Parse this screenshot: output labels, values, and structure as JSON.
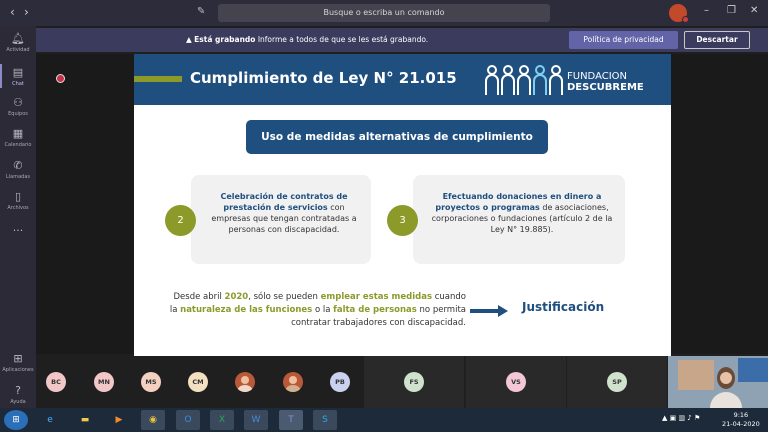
{
  "titlebar": {
    "back": "‹",
    "forward": "›",
    "search_placeholder": "Busque o escriba un comando",
    "minimize": "–",
    "maximize": "❐",
    "close": "✕"
  },
  "sidebar": {
    "items": [
      {
        "label": "Actividad",
        "icon": "bell-icon"
      },
      {
        "label": "Chat",
        "icon": "chat-icon"
      },
      {
        "label": "Equipos",
        "icon": "teams-icon"
      },
      {
        "label": "Calendario",
        "icon": "calendar-icon"
      },
      {
        "label": "Llamadas",
        "icon": "phone-icon"
      },
      {
        "label": "Archivos",
        "icon": "files-icon"
      },
      {
        "label": "···",
        "icon": "more-icon"
      },
      {
        "label": "Aplicaciones",
        "icon": "apps-icon"
      },
      {
        "label": "Ayuda",
        "icon": "help-icon"
      }
    ]
  },
  "banner": {
    "bold": "Está grabando",
    "text": "Informe a todos de que se les está grabando.",
    "privacy_button": "Política de privacidad",
    "dismiss_button": "Descartar"
  },
  "slide": {
    "title": "Cumplimiento de Ley N° 21.015",
    "logo_line1": "FUNDACION",
    "logo_line2": "DESCUBREME",
    "subtitle": "Uso de medidas alternativas de cumplimiento",
    "card1_number": "2",
    "card1_bold": "Celebración de contratos de prestación de servicios",
    "card1_text": "con empresas que tengan contratadas a personas con discapacidad.",
    "card2_number": "3",
    "card2_bold": "Efectuando donaciones en dinero a proyectos o programas",
    "card2_text": "de asociaciones, corporaciones o fundaciones (artículo 2 de la Ley N° 19.885).",
    "bottom_1": "Desde abril ",
    "bottom_year": "2020",
    "bottom_2": ", sólo se pueden ",
    "bottom_hl1": "emplear estas medidas",
    "bottom_3": " cuando la ",
    "bottom_hl2": "naturaleza de las funciones",
    "bottom_4": " o la ",
    "bottom_hl3": "falta de personas",
    "bottom_5": " no permita contratar trabajadores con discapacidad.",
    "justification": "Justificación"
  },
  "participants": [
    {
      "initials": "BC",
      "color": "#f3c7c7"
    },
    {
      "initials": "MN",
      "color": "#f3c7c7"
    },
    {
      "initials": "MS",
      "color": "#f3d0c0"
    },
    {
      "initials": "CM",
      "color": "#f2e0c0"
    },
    {
      "initials": "",
      "color": "#b85a3a"
    },
    {
      "initials": "",
      "color": "#b85a3a"
    },
    {
      "initials": "PB",
      "color": "#c9d2ee"
    }
  ],
  "tiles": [
    {
      "initials": "FS",
      "color": "#cfe2cc"
    },
    {
      "initials": "VS",
      "color": "#f3c7d5"
    },
    {
      "initials": "SP",
      "color": "#cfe2cc"
    }
  ],
  "taskbar": {
    "time": "9:16",
    "date": "21-04-2020"
  },
  "colors": {
    "accent": "#6264a7",
    "slide_blue": "#1f4f7f",
    "slide_green": "#8c9a2a"
  }
}
